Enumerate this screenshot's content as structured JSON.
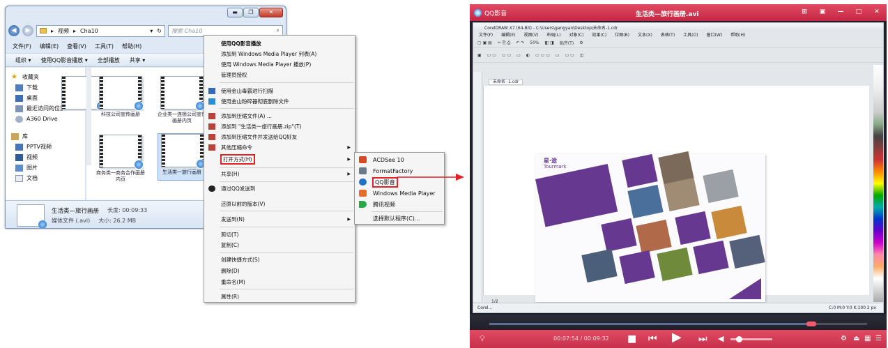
{
  "explorer": {
    "title_buttons": [
      "▬",
      "❐",
      "✕"
    ],
    "breadcrumb": [
      "▸",
      "视频",
      "▸",
      "Cha10"
    ],
    "search_placeholder": "搜索 Cha10",
    "menu": [
      "文件(F)",
      "编辑(E)",
      "查看(V)",
      "工具(T)",
      "帮助(H)"
    ],
    "toolbar": [
      "组织 ▾",
      "使用QQ影音播放 ▾",
      "全部播放",
      "共享 ▾"
    ],
    "nav": [
      {
        "label": "收藏夹",
        "icon": "star-icon"
      },
      {
        "label": "下载",
        "icon": "download-icon"
      },
      {
        "label": "桌面",
        "icon": "desktop-icon"
      },
      {
        "label": "最近访问的位置",
        "icon": "recent-icon"
      },
      {
        "label": "A360 Drive",
        "icon": "cloud-icon"
      },
      {
        "label": "库",
        "icon": "library-icon"
      },
      {
        "label": "PPTV视频",
        "icon": "video-icon"
      },
      {
        "label": "视频",
        "icon": "video-icon"
      },
      {
        "label": "图片",
        "icon": "picture-icon"
      },
      {
        "label": "文档",
        "icon": "document-icon"
      }
    ],
    "files": [
      {
        "name": ""
      },
      {
        "name": "科技公司宣传画册"
      },
      {
        "name": "企业类一连锁公司宣传画册内页"
      },
      {
        "name": "商务类一商务合作画册内页"
      },
      {
        "name": "生活类一旅行画册"
      }
    ],
    "status": {
      "name": "生活类—旅行画册",
      "length": "长度: 00:09:33",
      "type": "媒体文件 (.avi)",
      "size": "大小: 26.2 MB"
    }
  },
  "context_menu": {
    "items": [
      {
        "label": "使用QQ影音播放",
        "bold": true
      },
      {
        "label": "添加到 Windows Media Player 列表(A)"
      },
      {
        "label": "使用 Windows Media Player 播放(P)"
      },
      {
        "label": "管理员授权"
      },
      {
        "label": "使用金山毒霸进行扫描",
        "icon": "shield-icon"
      },
      {
        "label": "使用金山粉碎器彻底删除文件",
        "icon": "shred-icon"
      },
      {
        "label": "添加到压缩文件(A) ...",
        "icon": "archive-icon"
      },
      {
        "label": "添加到 \"生活类一旅行画册.zip\"(T)",
        "icon": "archive-icon"
      },
      {
        "label": "添加到压缩文件并发送给QQ好友",
        "icon": "archive-icon"
      },
      {
        "label": "其他压缩命令",
        "icon": "archive-icon",
        "submenu": true
      },
      {
        "label": "打开方式(H)",
        "submenu": true,
        "highlighted": true
      },
      {
        "label": "共享(H)",
        "submenu": true
      },
      {
        "label": "通过QQ发送到",
        "icon": "qq-icon"
      },
      {
        "label": "还原以前的版本(V)"
      },
      {
        "label": "发送到(N)",
        "submenu": true
      },
      {
        "label": "剪切(T)"
      },
      {
        "label": "复制(C)"
      },
      {
        "label": "创建快捷方式(S)"
      },
      {
        "label": "删除(D)"
      },
      {
        "label": "重命名(M)"
      },
      {
        "label": "属性(R)"
      }
    ]
  },
  "open_with": {
    "items": [
      {
        "label": "ACDSee 10",
        "color": "#d9472b"
      },
      {
        "label": "FormatFactory",
        "color": "#6b7b8c"
      },
      {
        "label": "QQ影音",
        "color": "#1e73c8",
        "highlighted": true
      },
      {
        "label": "Windows Media Player",
        "color": "#e8692a"
      },
      {
        "label": "腾讯视频",
        "color": "#29a84a"
      },
      {
        "label": "选择默认程序(C)..."
      }
    ]
  },
  "player": {
    "app_name": "QQ影音",
    "title": "生活类—旅行画册.avi",
    "window_controls": [
      "⊞",
      "▣",
      "—",
      "□",
      "✕"
    ],
    "corel": {
      "title": "CorelDRAW X7 (64-Bit) - C:\\Users\\gangyan\\Desktop\\未命名-1.cdr",
      "menu": [
        "文件(F)",
        "编辑(E)",
        "视图(V)",
        "布局(L)",
        "对象(C)",
        "效果(C)",
        "位图(B)",
        "文本(X)",
        "表格(T)",
        "工具(O)",
        "窗口(W)",
        "帮助(H)"
      ],
      "zoom": "50%",
      "snap_label": "贴齐(T)",
      "tab": "未命名 -1.cdr",
      "page_nav": "1/2",
      "status_left": "Corel...",
      "status_right": "C:0 M:0 Y:0 K:100  2 px",
      "brand": "星·途",
      "brand_sub": "Tourmark"
    },
    "time": "00:07:54 / 00:09:32",
    "accent": "#d9344f"
  }
}
